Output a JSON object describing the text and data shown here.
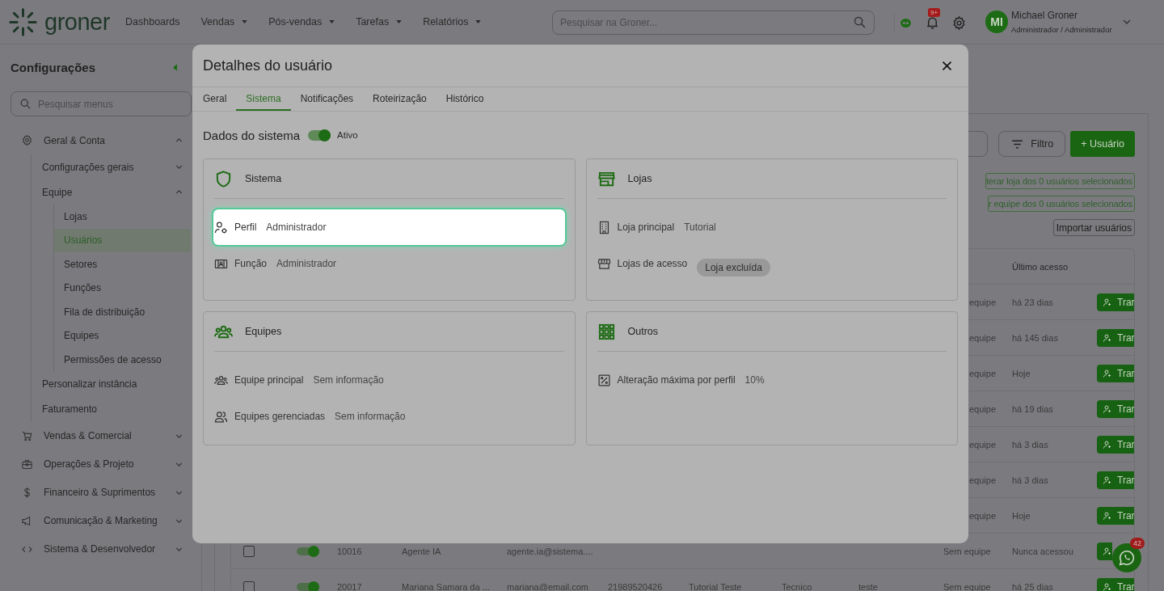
{
  "header": {
    "logo": "groner",
    "nav": [
      {
        "label": "Dashboards",
        "dropdown": false
      },
      {
        "label": "Vendas",
        "dropdown": true
      },
      {
        "label": "Pós-vendas",
        "dropdown": true
      },
      {
        "label": "Tarefas",
        "dropdown": true
      },
      {
        "label": "Relatórios",
        "dropdown": true
      }
    ],
    "search": {
      "placeholder": "Pesquisar na Groner..."
    },
    "notifications_badge": "9+",
    "user": {
      "initials": "MI",
      "name": "Michael Groner",
      "role": "Administrador / Administrador"
    }
  },
  "sidebar": {
    "title": "Configurações",
    "search": {
      "placeholder": "Pesquisar menus"
    },
    "items": [
      {
        "label": "Geral & Conta",
        "expanded": true,
        "selected": false,
        "children": [
          {
            "label": "Configurações gerais",
            "expanded": false,
            "selected": false
          },
          {
            "label": "Equipe",
            "expanded": true,
            "selected": false,
            "children": [
              {
                "label": "Lojas",
                "selected": false
              },
              {
                "label": "Usuários",
                "selected": true
              },
              {
                "label": "Setores",
                "selected": false
              },
              {
                "label": "Funções",
                "selected": false
              },
              {
                "label": "Fila de distribuição",
                "selected": false
              },
              {
                "label": "Equipes",
                "selected": false
              },
              {
                "label": "Permissões de acesso",
                "selected": false
              }
            ]
          },
          {
            "label": "Personalizar instância",
            "selected": false
          },
          {
            "label": "Faturamento",
            "selected": false
          }
        ]
      },
      {
        "label": "Vendas & Comercial",
        "expanded": false,
        "selected": false
      },
      {
        "label": "Operações & Projeto",
        "expanded": false,
        "selected": false
      },
      {
        "label": "Financeiro & Suprimentos",
        "expanded": false,
        "selected": false
      },
      {
        "label": "Comunicação & Marketing",
        "expanded": false,
        "selected": false
      },
      {
        "label": "Sistema & Desenvolvedor",
        "expanded": false,
        "selected": false
      }
    ]
  },
  "main": {
    "filter_button": "Filtro",
    "add_button": "+ Usuário",
    "bulk_actions": [
      "terar loja dos 0 usuários selecionados",
      "r equipe dos 0 usuários selecionados"
    ],
    "import_button": "Importar usuários",
    "table": {
      "last_access_heading": "Último acesso",
      "rows": [
        {
          "team": "equipe",
          "last_access": "há 23 dias",
          "action": "Trar"
        },
        {
          "team": "equipe",
          "last_access": "há 145 dias",
          "action": "Trar"
        },
        {
          "team": "equipe",
          "last_access": "Hoje",
          "action": "Trar"
        },
        {
          "team": "equipe",
          "last_access": "há 19 dias",
          "action": "Trar"
        },
        {
          "team": "equipe",
          "last_access": "há 3 dias",
          "action": "Trar"
        },
        {
          "team": "equipe",
          "last_access": "há 3 dias",
          "action": "Trar"
        },
        {
          "team": "equipe",
          "last_access": "Hoje",
          "action": "Trar"
        },
        {
          "selected": false,
          "active": true,
          "code": "10016",
          "name": "Agente IA",
          "email": "agente.ia@sistema....",
          "team": "Sem equipe",
          "last_access": "Nunca acessou"
        },
        {
          "selected": false,
          "active": true,
          "code": "20017",
          "name": "Mariana Samara da ...",
          "email": "mariana@email.com",
          "phone": "21989520426",
          "function": "Tutorial Teste",
          "type": "Tecnico",
          "extra": "teste",
          "team": "Sem equipe",
          "last_access": "há 25 dias",
          "action": "Trar"
        }
      ]
    }
  },
  "modal": {
    "title": "Detalhes do usuário",
    "tabs": [
      {
        "label": "Geral",
        "selected": false
      },
      {
        "label": "Sistema",
        "selected": true
      },
      {
        "label": "Notificações",
        "selected": false
      },
      {
        "label": "Roteirização",
        "selected": false
      },
      {
        "label": "Histórico",
        "selected": false
      }
    ],
    "section_title": "Dados do sistema",
    "status": {
      "on": true,
      "label": "Ativo"
    },
    "cards": [
      {
        "title": "Sistema",
        "rows": [
          {
            "label": "Perfil",
            "value": "Administrador",
            "kind": "text",
            "highlighted": true
          },
          {
            "label": "Função",
            "value": "Administrador",
            "kind": "text",
            "highlighted": false
          }
        ]
      },
      {
        "title": "Lojas",
        "rows": [
          {
            "label": "Loja principal",
            "value": "Tutorial",
            "kind": "text",
            "highlighted": false
          },
          {
            "label": "Lojas de acesso",
            "value": "Loja excluída",
            "kind": "chip",
            "highlighted": false
          }
        ]
      },
      {
        "title": "Equipes",
        "rows": [
          {
            "label": "Equipe principal",
            "value": "Sem informação",
            "kind": "text",
            "highlighted": false
          },
          {
            "label": "Equipes gerenciadas",
            "value": "Sem informação",
            "kind": "text",
            "highlighted": false
          }
        ]
      },
      {
        "title": "Outros",
        "rows": [
          {
            "label": "Alteração máxima por perfil",
            "value": "10%",
            "kind": "text",
            "highlighted": false
          }
        ]
      }
    ]
  },
  "chat": {
    "badge": "42"
  }
}
